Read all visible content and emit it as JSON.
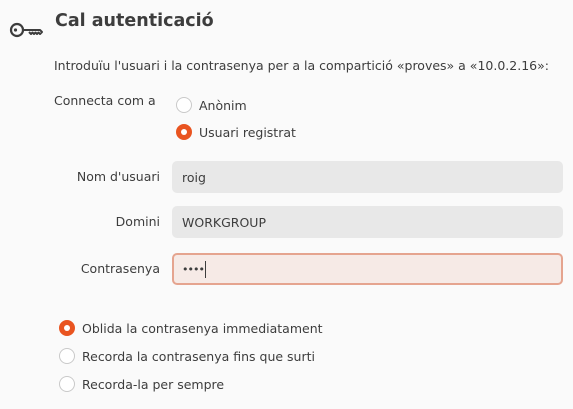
{
  "header": {
    "title": "Cal autenticació",
    "icon": "key-icon"
  },
  "message": "Introduïu l'usuari i la contrasenya per a la compartició «proves» a «10.0.2.16»:",
  "connect_as": {
    "label": "Connecta com a",
    "options": [
      {
        "label": "Anònim",
        "checked": false
      },
      {
        "label": "Usuari registrat",
        "checked": true
      }
    ]
  },
  "fields": {
    "username": {
      "label": "Nom d'usuari",
      "value": "roig"
    },
    "domain": {
      "label": "Domini",
      "value": "WORKGROUP"
    },
    "password": {
      "label": "Contrasenya",
      "value": "••••"
    }
  },
  "remember": {
    "options": [
      {
        "label": "Oblida la contrasenya immediatament",
        "checked": true
      },
      {
        "label": "Recorda la contrasenya fins que surti",
        "checked": false
      },
      {
        "label": "Recorda-la per sempre",
        "checked": false
      }
    ]
  },
  "colors": {
    "accent": "#e95420",
    "text": "#3d3d3d",
    "entry_bg": "#e8e8e8",
    "focus_border": "#e5a48f"
  }
}
